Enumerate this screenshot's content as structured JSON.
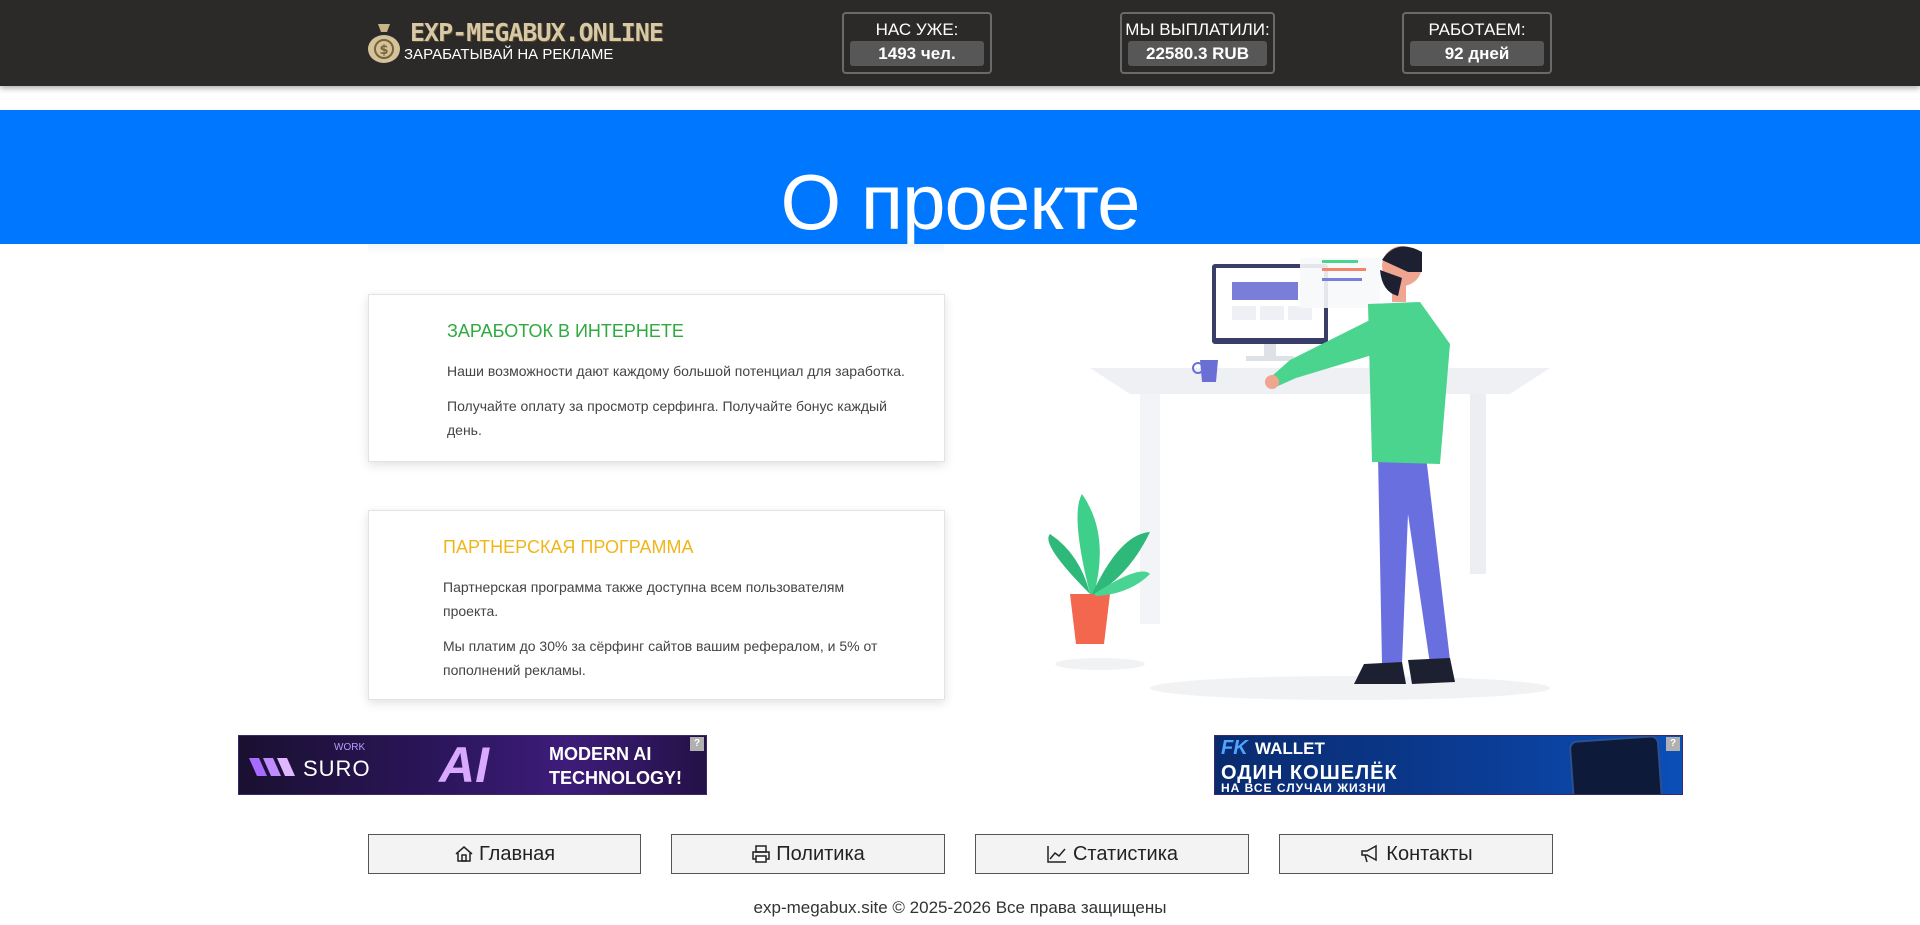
{
  "header": {
    "logo_title": "EXP-MEGABUX.ONLINE",
    "logo_subtitle": "ЗАРАБАТЫВАЙ НА РЕКЛАМЕ",
    "stats": [
      {
        "label": "НАС УЖЕ:",
        "value": "1493 чел."
      },
      {
        "label": "МЫ ВЫПЛАТИЛИ:",
        "value": "22580.3 RUB"
      },
      {
        "label": "РАБОТАЕМ:",
        "value": "92 дней"
      }
    ]
  },
  "hero": {
    "title": "О проекте"
  },
  "cards": [
    {
      "title": "ЗАРАБОТОК В ИНТЕРНЕТЕ",
      "title_color": "#2eaa3f",
      "paragraphs": [
        "Наши возможности дают каждому большой потенциал для заработка.",
        "Получайте оплату за просмотр серфинга. Получайте бонус каждый день."
      ]
    },
    {
      "title": "ПАРТНЕРСКАЯ ПРОГРАММА",
      "title_color": "#f0b519",
      "paragraphs": [
        "Партнерская программа также доступна всем пользователям проекта.",
        "Мы платим до 30% за сёрфинг сайтов вашим рефералом, и 5% от пополнений рекламы."
      ]
    }
  ],
  "banners": {
    "left": {
      "brand": "SURO",
      "brand_small": "WORK",
      "big": "AI",
      "line1": "MODERN AI",
      "line2": "TECHNOLOGY!",
      "help": "?"
    },
    "right": {
      "brand": "WALLET",
      "logo": "FK",
      "line1": "ОДИН КОШЕЛЁК",
      "line2": "НА ВСЕ СЛУЧАИ ЖИЗНИ",
      "help": "?"
    }
  },
  "nav": [
    {
      "label": "Главная",
      "icon": "home-icon"
    },
    {
      "label": "Политика",
      "icon": "printer-icon"
    },
    {
      "label": "Статистика",
      "icon": "chart-line-icon"
    },
    {
      "label": "Контакты",
      "icon": "megaphone-icon"
    }
  ],
  "footer": {
    "copyright": "exp-megabux.site © 2025-2026 Все права защищены"
  },
  "colors": {
    "header_bg": "#2b2a29",
    "hero_bg": "#0077ff",
    "stat_value_bg": "#575757"
  }
}
